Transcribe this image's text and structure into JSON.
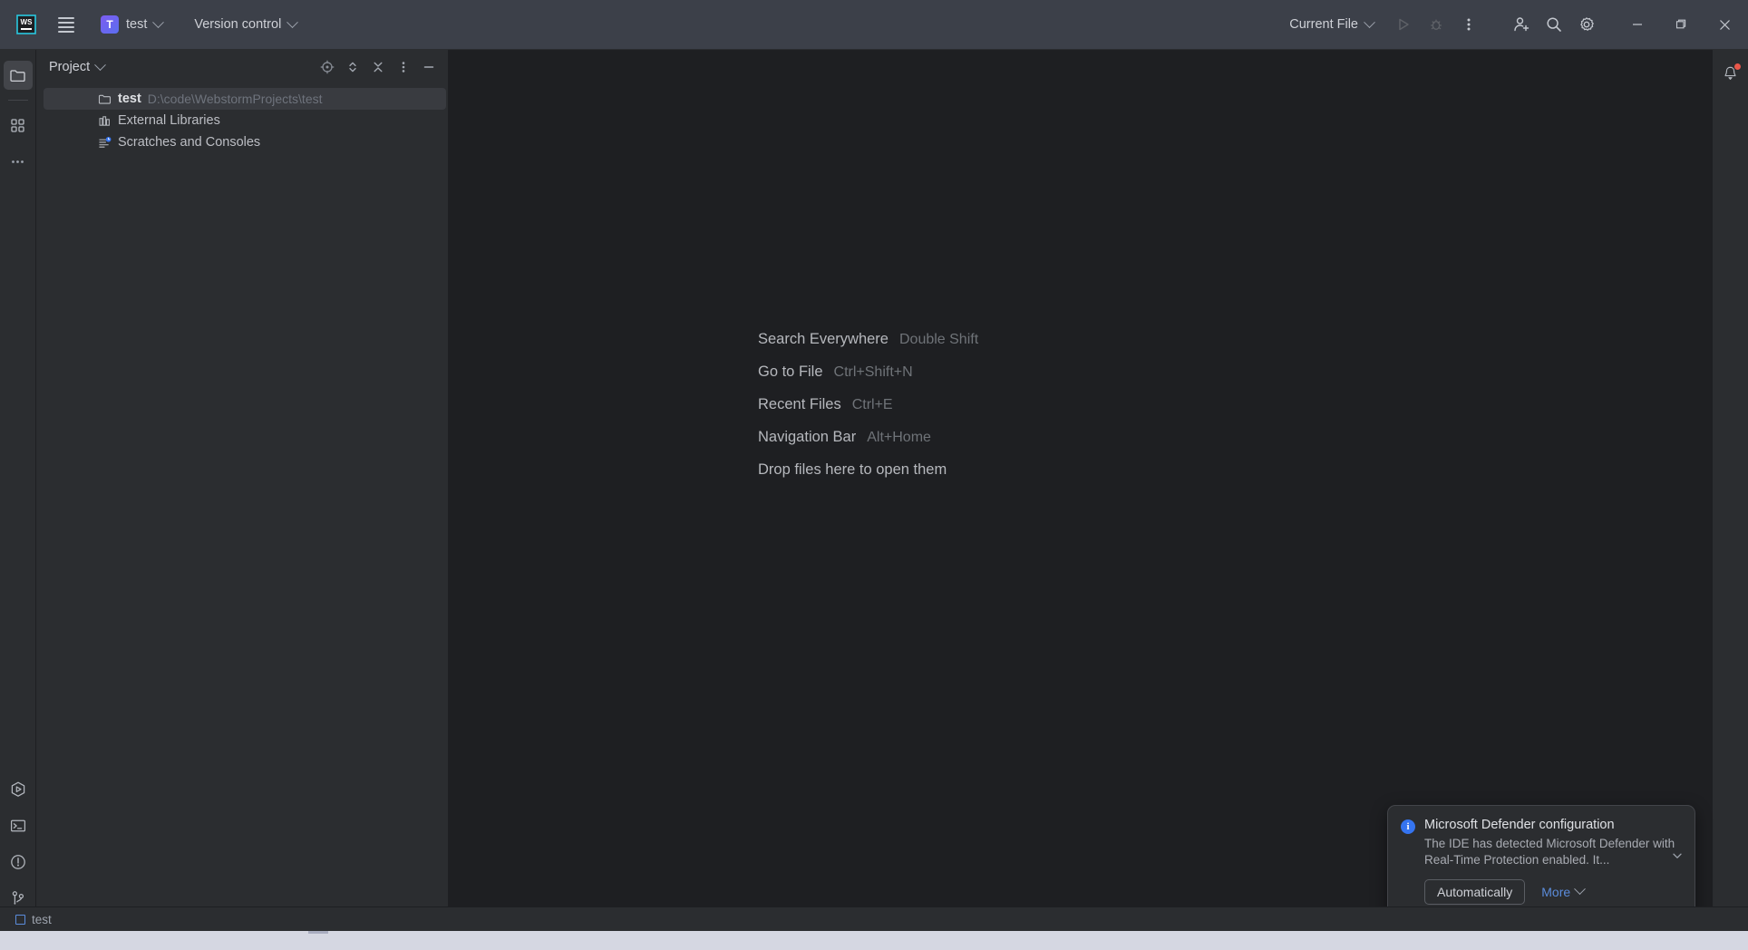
{
  "titlebar": {
    "logo_name": "webstorm-logo",
    "menu_label": "Main Menu",
    "project_initial": "T",
    "project_name": "test",
    "vcs_label": "Version control",
    "run_config_label": "Current File",
    "run_tooltip": "Run",
    "debug_tooltip": "Debug",
    "more_tooltip": "More Actions",
    "account_tooltip": "Your Account",
    "search_tooltip": "Search Everywhere",
    "settings_tooltip": "Settings",
    "minimize_tooltip": "Minimize",
    "maximize_tooltip": "Restore Down",
    "close_tooltip": "Close"
  },
  "left_rail": {
    "top": [
      {
        "name": "project",
        "tooltip": "Project"
      },
      {
        "name": "commit",
        "tooltip": "Commit"
      },
      {
        "name": "more-tool-windows",
        "tooltip": "More Tool Windows"
      }
    ],
    "bottom": [
      {
        "name": "run",
        "tooltip": "Run"
      },
      {
        "name": "terminal",
        "tooltip": "Terminal"
      },
      {
        "name": "problems",
        "tooltip": "Problems"
      },
      {
        "name": "version-control",
        "tooltip": "Version Control"
      }
    ]
  },
  "project_panel": {
    "title": "Project",
    "actions": [
      {
        "name": "select-opened-file",
        "tooltip": "Select Opened File"
      },
      {
        "name": "expand-all",
        "tooltip": "Expand All"
      },
      {
        "name": "collapse-all",
        "tooltip": "Collapse All"
      },
      {
        "name": "options",
        "tooltip": "Options"
      },
      {
        "name": "hide",
        "tooltip": "Hide"
      }
    ],
    "tree": [
      {
        "label": "test",
        "path": "D:\\code\\WebstormProjects\\test",
        "icon": "folder-icon",
        "selected": true
      },
      {
        "label": "External Libraries",
        "path": "",
        "icon": "library-icon",
        "selected": false
      },
      {
        "label": "Scratches and Consoles",
        "path": "",
        "icon": "scratches-icon",
        "selected": false
      }
    ]
  },
  "editor": {
    "shortcuts": [
      {
        "label": "Search Everywhere",
        "key": "Double Shift"
      },
      {
        "label": "Go to File",
        "key": "Ctrl+Shift+N"
      },
      {
        "label": "Recent Files",
        "key": "Ctrl+E"
      },
      {
        "label": "Navigation Bar",
        "key": "Alt+Home"
      },
      {
        "label": "Drop files here to open them",
        "key": ""
      }
    ]
  },
  "right_rail": {
    "notifications_tooltip": "Notifications"
  },
  "notification": {
    "icon": "info-icon",
    "icon_char": "i",
    "title": "Microsoft Defender configuration",
    "body": "The IDE has detected Microsoft Defender with Real-Time Protection enabled. It...",
    "primary_action": "Automatically",
    "more_label": "More",
    "collapse_tooltip": "Collapse"
  },
  "statusbar": {
    "project_label": "test"
  },
  "colors": {
    "titlebar_bg": "#3c4049",
    "panel_bg": "#2b2d30",
    "editor_bg": "#1e1f22",
    "accent_blue": "#3574f0",
    "link_blue": "#5b8cdb",
    "badge_red": "#e9574a",
    "text_primary": "#ced0d6",
    "text_muted": "#6e737c"
  }
}
